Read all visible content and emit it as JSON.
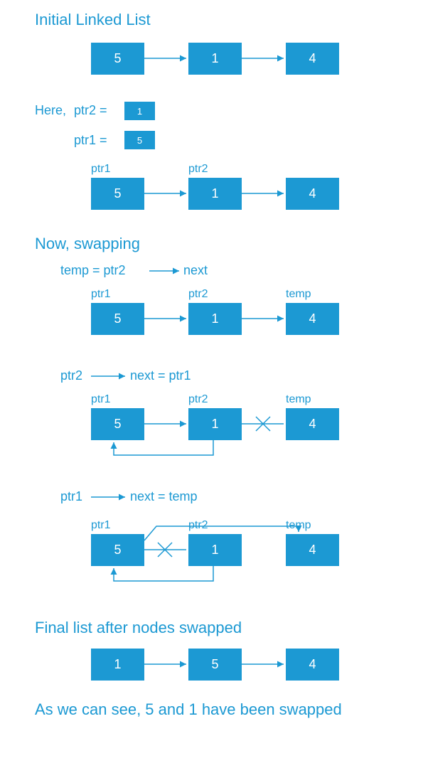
{
  "colors": {
    "accent": "#1c99d3"
  },
  "headings": {
    "initial": "Initial Linked List",
    "swapping": "Now,   swapping",
    "final": "Final list after nodes swapped",
    "conclusion": "As we can see,  5 and 1 have been swapped"
  },
  "labels": {
    "here": "Here,",
    "ptr2_eq": "ptr2  =",
    "ptr1_eq": "ptr1  =",
    "ptr1": "ptr1",
    "ptr2": "ptr2",
    "temp": "temp",
    "step1": "temp  =  ptr2",
    "step1_next": "next",
    "step2_lhs": "ptr2",
    "step2_rhs": "next  =  ptr1",
    "step3_lhs": "ptr1",
    "step3_rhs": "next  =  temp"
  },
  "nodes": {
    "five": "5",
    "one": "1",
    "four": "4"
  },
  "mini": {
    "one": "1",
    "five": "5"
  }
}
